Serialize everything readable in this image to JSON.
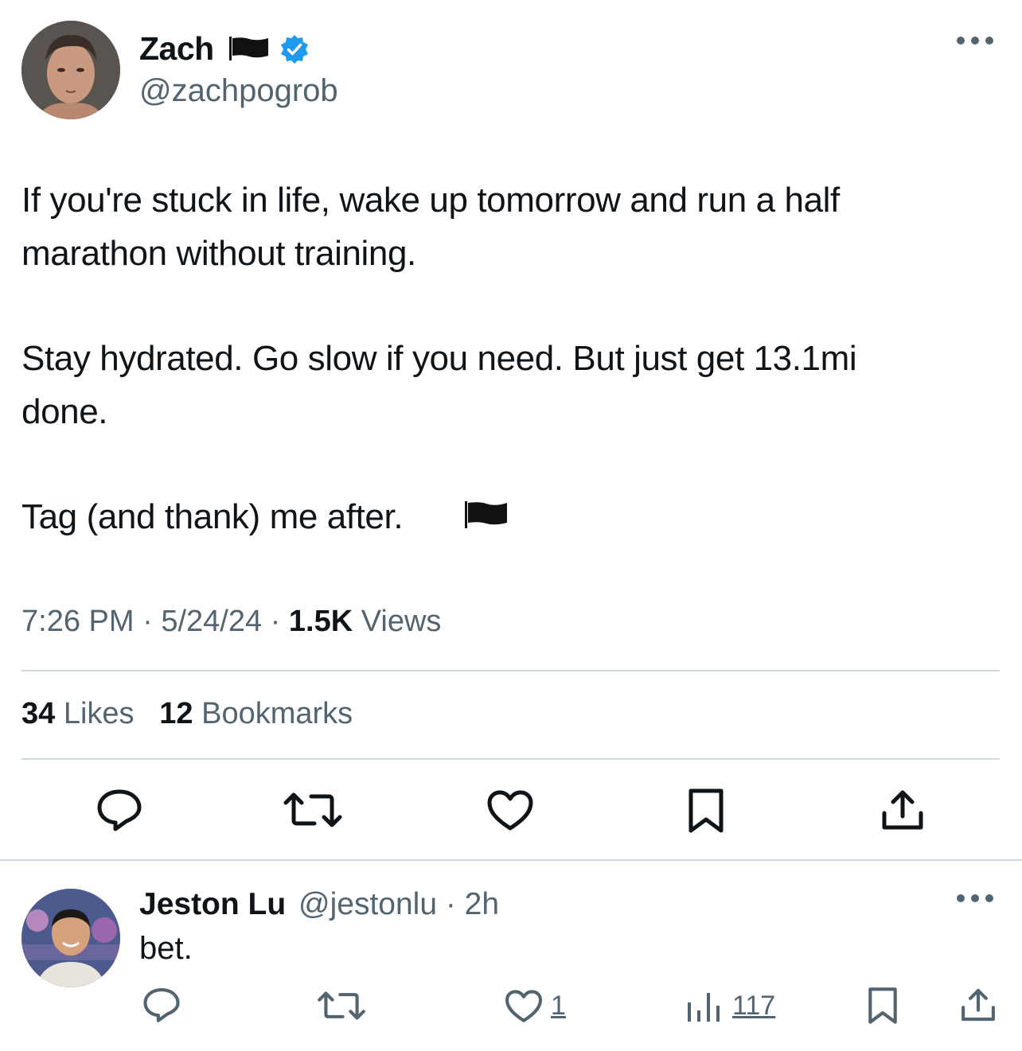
{
  "tweet": {
    "author_name": "Zach",
    "author_handle": "@zachpogrob",
    "lines": [
      "If you're stuck in life, wake up tomorrow and run a half",
      "marathon without training.",
      "Stay hydrated. Go slow if you need. But just get 13.1mi",
      "done.",
      "Tag (and thank) me after."
    ],
    "time": "7:26 PM",
    "date": "5/24/24",
    "views_count": "1.5K",
    "views_label": "Views",
    "likes_count": "34",
    "likes_label": "Likes",
    "bookmarks_count": "12",
    "bookmarks_label": "Bookmarks",
    "separator": "·"
  },
  "reply": {
    "author_name": "Jeston Lu",
    "author_handle": "@jestonlu · 2h",
    "text": "bet.",
    "like_count": "1",
    "views_count": "117"
  },
  "icons": {
    "flag": "black-flag-icon",
    "verified": "verified-badge-icon",
    "more": "more-options-icon",
    "reply": "reply-icon",
    "retweet": "retweet-icon",
    "like": "like-icon",
    "bookmark": "bookmark-icon",
    "share": "share-icon",
    "views": "views-chart-icon"
  },
  "colors": {
    "text": "#0f1419",
    "secondary": "#536471",
    "verified": "#1d9bf0",
    "divider": "#cfd9de"
  }
}
